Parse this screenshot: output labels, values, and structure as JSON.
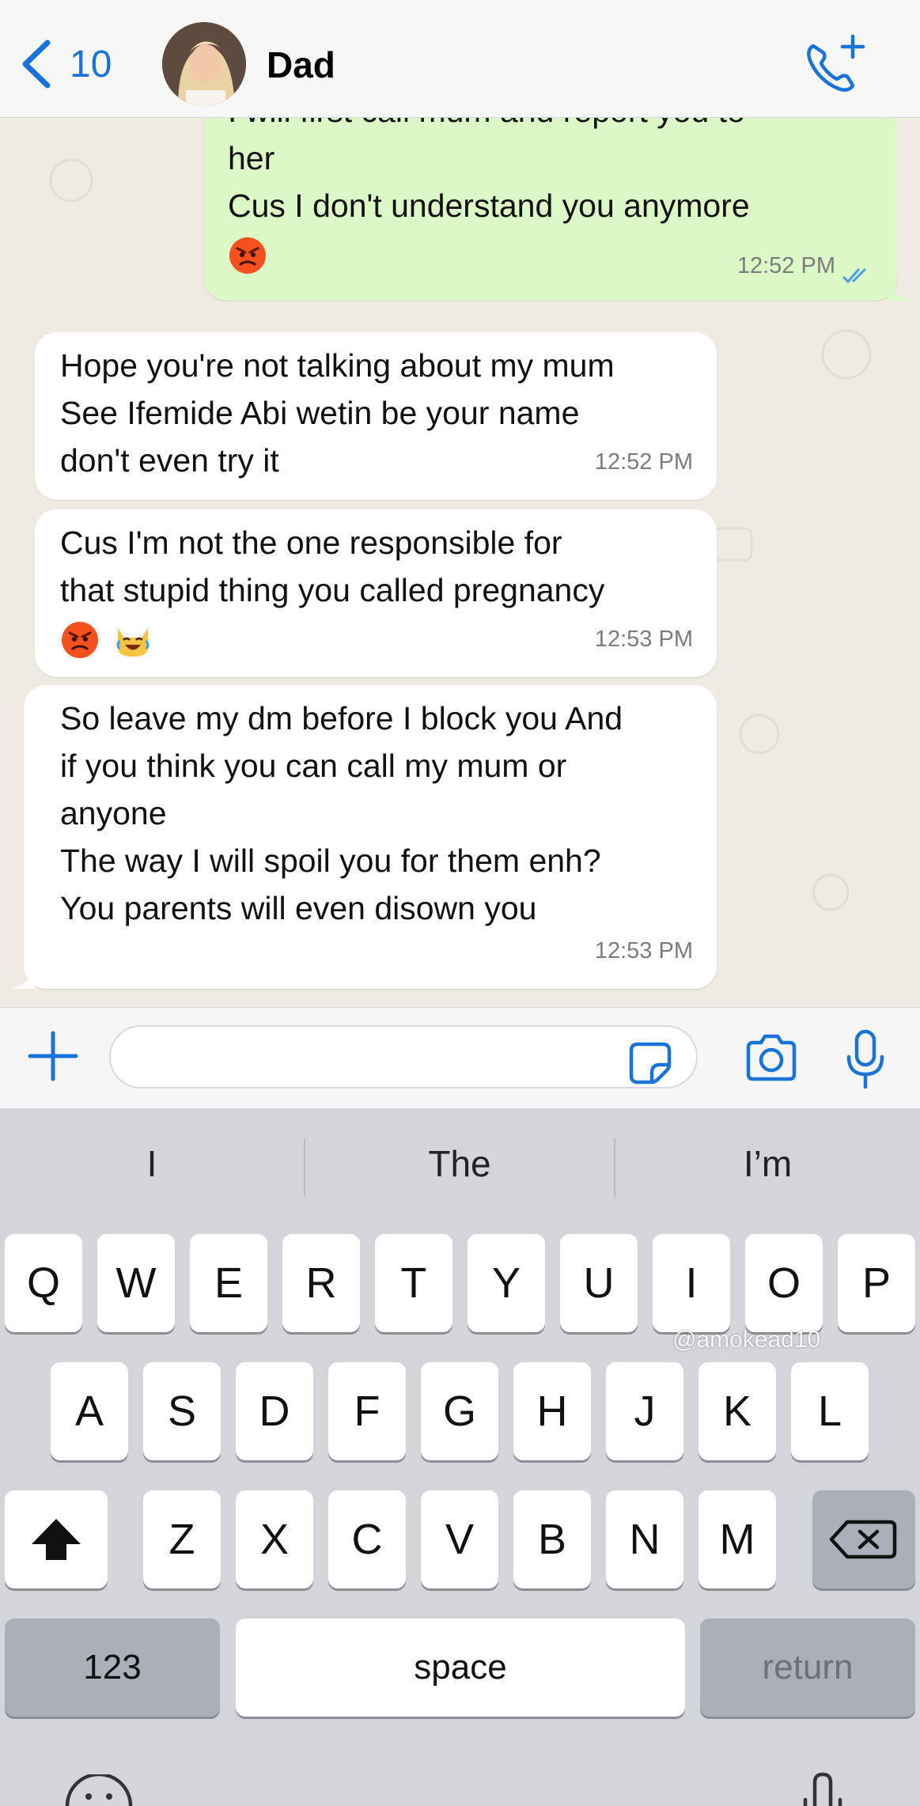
{
  "header": {
    "back_count": "10",
    "contact_name": "Dad"
  },
  "messages": [
    {
      "direction": "out",
      "lines": [
        "I will first call mum and report you to",
        "her",
        "Cus I don't understand you anymore"
      ],
      "emoji": [
        "angry-face"
      ],
      "time": "12:52 PM",
      "status": "read"
    },
    {
      "direction": "in",
      "lines": [
        "Hope you're not talking about my mum",
        "See Ifemide Abi wetin be your name",
        "don't even try it"
      ],
      "time": "12:52 PM"
    },
    {
      "direction": "in",
      "lines": [
        "Cus I'm not the one responsible for",
        "that stupid thing you called pregnancy"
      ],
      "emoji": [
        "angry-face",
        "laughing-cat-face"
      ],
      "time": "12:53 PM"
    },
    {
      "direction": "in",
      "lines": [
        "So leave my dm before I block you And",
        "if you think you can call my mum or",
        "anyone",
        "The way I will spoil you for them enh?",
        "You parents will even disown you"
      ],
      "time": "12:53 PM"
    }
  ],
  "input": {
    "value": "",
    "placeholder": ""
  },
  "keyboard": {
    "suggestions": [
      "I",
      "The",
      "I’m"
    ],
    "row1": [
      "Q",
      "W",
      "E",
      "R",
      "T",
      "Y",
      "U",
      "I",
      "O",
      "P"
    ],
    "row2": [
      "A",
      "S",
      "D",
      "F",
      "G",
      "H",
      "J",
      "K",
      "L"
    ],
    "row3": [
      "Z",
      "X",
      "C",
      "V",
      "B",
      "N",
      "M"
    ],
    "numbers_key": "123",
    "space_key": "space",
    "return_key": "return"
  },
  "watermark": "@amokead10",
  "colors": {
    "accent": "#1a73d9",
    "outgoing_bubble": "#dcf8c6",
    "incoming_bubble": "#ffffff",
    "chat_background": "#efeae2",
    "keyboard_background": "#d3d5db"
  }
}
